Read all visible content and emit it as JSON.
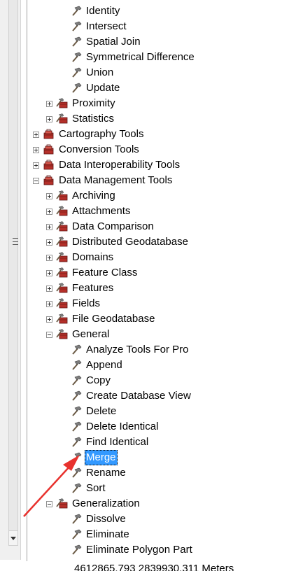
{
  "tree": {
    "items": [
      {
        "label": "Identity",
        "kind": "tool",
        "level": 3
      },
      {
        "label": "Intersect",
        "kind": "tool",
        "level": 3
      },
      {
        "label": "Spatial Join",
        "kind": "tool",
        "level": 3
      },
      {
        "label": "Symmetrical Difference",
        "kind": "tool",
        "level": 3
      },
      {
        "label": "Union",
        "kind": "tool",
        "level": 3
      },
      {
        "label": "Update",
        "kind": "tool",
        "level": 3
      },
      {
        "label": "Proximity",
        "kind": "toolset",
        "level": 2,
        "expanded": false
      },
      {
        "label": "Statistics",
        "kind": "toolset",
        "level": 2,
        "expanded": false
      },
      {
        "label": "Cartography Tools",
        "kind": "toolbox",
        "level": 1,
        "expanded": false
      },
      {
        "label": "Conversion Tools",
        "kind": "toolbox",
        "level": 1,
        "expanded": false
      },
      {
        "label": "Data Interoperability Tools",
        "kind": "toolbox",
        "level": 1,
        "expanded": false
      },
      {
        "label": "Data Management Tools",
        "kind": "toolbox",
        "level": 1,
        "expanded": true
      },
      {
        "label": "Archiving",
        "kind": "toolset",
        "level": 2,
        "expanded": false
      },
      {
        "label": "Attachments",
        "kind": "toolset",
        "level": 2,
        "expanded": false
      },
      {
        "label": "Data Comparison",
        "kind": "toolset",
        "level": 2,
        "expanded": false
      },
      {
        "label": "Distributed Geodatabase",
        "kind": "toolset",
        "level": 2,
        "expanded": false
      },
      {
        "label": "Domains",
        "kind": "toolset",
        "level": 2,
        "expanded": false
      },
      {
        "label": "Feature Class",
        "kind": "toolset",
        "level": 2,
        "expanded": false
      },
      {
        "label": "Features",
        "kind": "toolset",
        "level": 2,
        "expanded": false
      },
      {
        "label": "Fields",
        "kind": "toolset",
        "level": 2,
        "expanded": false
      },
      {
        "label": "File Geodatabase",
        "kind": "toolset",
        "level": 2,
        "expanded": false
      },
      {
        "label": "General",
        "kind": "toolset",
        "level": 2,
        "expanded": true
      },
      {
        "label": "Analyze Tools For Pro",
        "kind": "tool",
        "level": 3
      },
      {
        "label": "Append",
        "kind": "tool",
        "level": 3
      },
      {
        "label": "Copy",
        "kind": "tool",
        "level": 3
      },
      {
        "label": "Create Database View",
        "kind": "tool",
        "level": 3
      },
      {
        "label": "Delete",
        "kind": "tool",
        "level": 3
      },
      {
        "label": "Delete Identical",
        "kind": "tool",
        "level": 3
      },
      {
        "label": "Find Identical",
        "kind": "tool",
        "level": 3
      },
      {
        "label": "Merge",
        "kind": "tool",
        "level": 3,
        "selected": true
      },
      {
        "label": "Rename",
        "kind": "tool",
        "level": 3
      },
      {
        "label": "Sort",
        "kind": "tool",
        "level": 3
      },
      {
        "label": "Generalization",
        "kind": "toolset",
        "level": 2,
        "expanded": true
      },
      {
        "label": "Dissolve",
        "kind": "tool",
        "level": 3
      },
      {
        "label": "Eliminate",
        "kind": "tool",
        "level": 3
      },
      {
        "label": "Eliminate Polygon Part",
        "kind": "tool",
        "level": 3
      }
    ]
  },
  "status": {
    "coordinates": "4612865.793 2839930.311 Meters"
  },
  "colors": {
    "selection": "#3399ff",
    "annotation_arrow": "#e8322e",
    "toolbox_red": "#b5302a"
  },
  "icons": {
    "tool": "hammer-icon",
    "toolset": "toolset-icon",
    "toolbox": "toolbox-icon"
  }
}
